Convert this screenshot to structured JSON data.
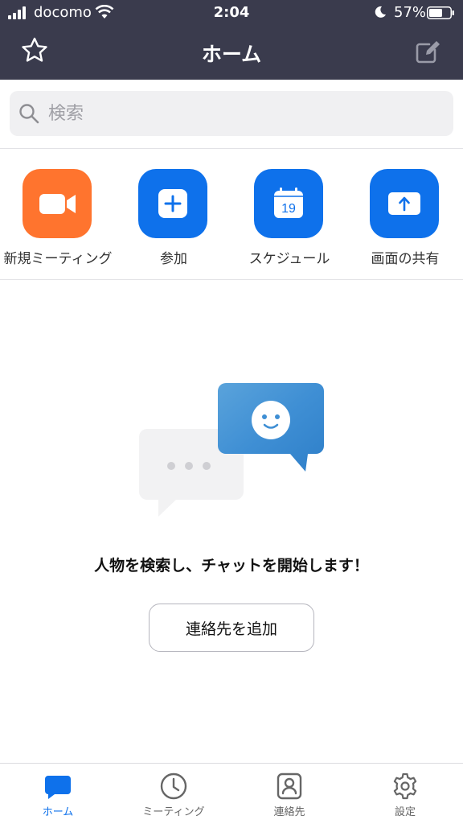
{
  "status_bar": {
    "carrier": "docomo",
    "time": "2:04",
    "battery_percent": "57%",
    "icons": [
      "signal-icon",
      "wifi-icon",
      "moon-icon",
      "battery-icon"
    ]
  },
  "navbar": {
    "title": "ホーム",
    "left_icon": "star-icon",
    "right_icon": "compose-icon"
  },
  "search": {
    "placeholder": "検索",
    "value": ""
  },
  "actions": [
    {
      "label": "新規ミーティング",
      "icon": "video-camera-icon",
      "color": "#ff742e"
    },
    {
      "label": "参加",
      "icon": "plus-icon",
      "color": "#0e71eb"
    },
    {
      "label": "スケジュール",
      "icon": "calendar-icon",
      "color": "#0e71eb",
      "icon_text": "19"
    },
    {
      "label": "画面の共有",
      "icon": "share-screen-icon",
      "color": "#0e71eb"
    }
  ],
  "empty_state": {
    "message": "人物を検索し、チャットを開始します！",
    "button_label": "連絡先を追加"
  },
  "tabbar": {
    "items": [
      {
        "label": "ホーム",
        "icon": "chat-bubble-icon",
        "active": true
      },
      {
        "label": "ミーティング",
        "icon": "clock-icon",
        "active": false
      },
      {
        "label": "連絡先",
        "icon": "contact-icon",
        "active": false
      },
      {
        "label": "設定",
        "icon": "gear-icon",
        "active": false
      }
    ]
  },
  "colors": {
    "header_bg": "#3a3b4d",
    "accent_blue": "#0e71eb",
    "accent_orange": "#ff742e"
  }
}
